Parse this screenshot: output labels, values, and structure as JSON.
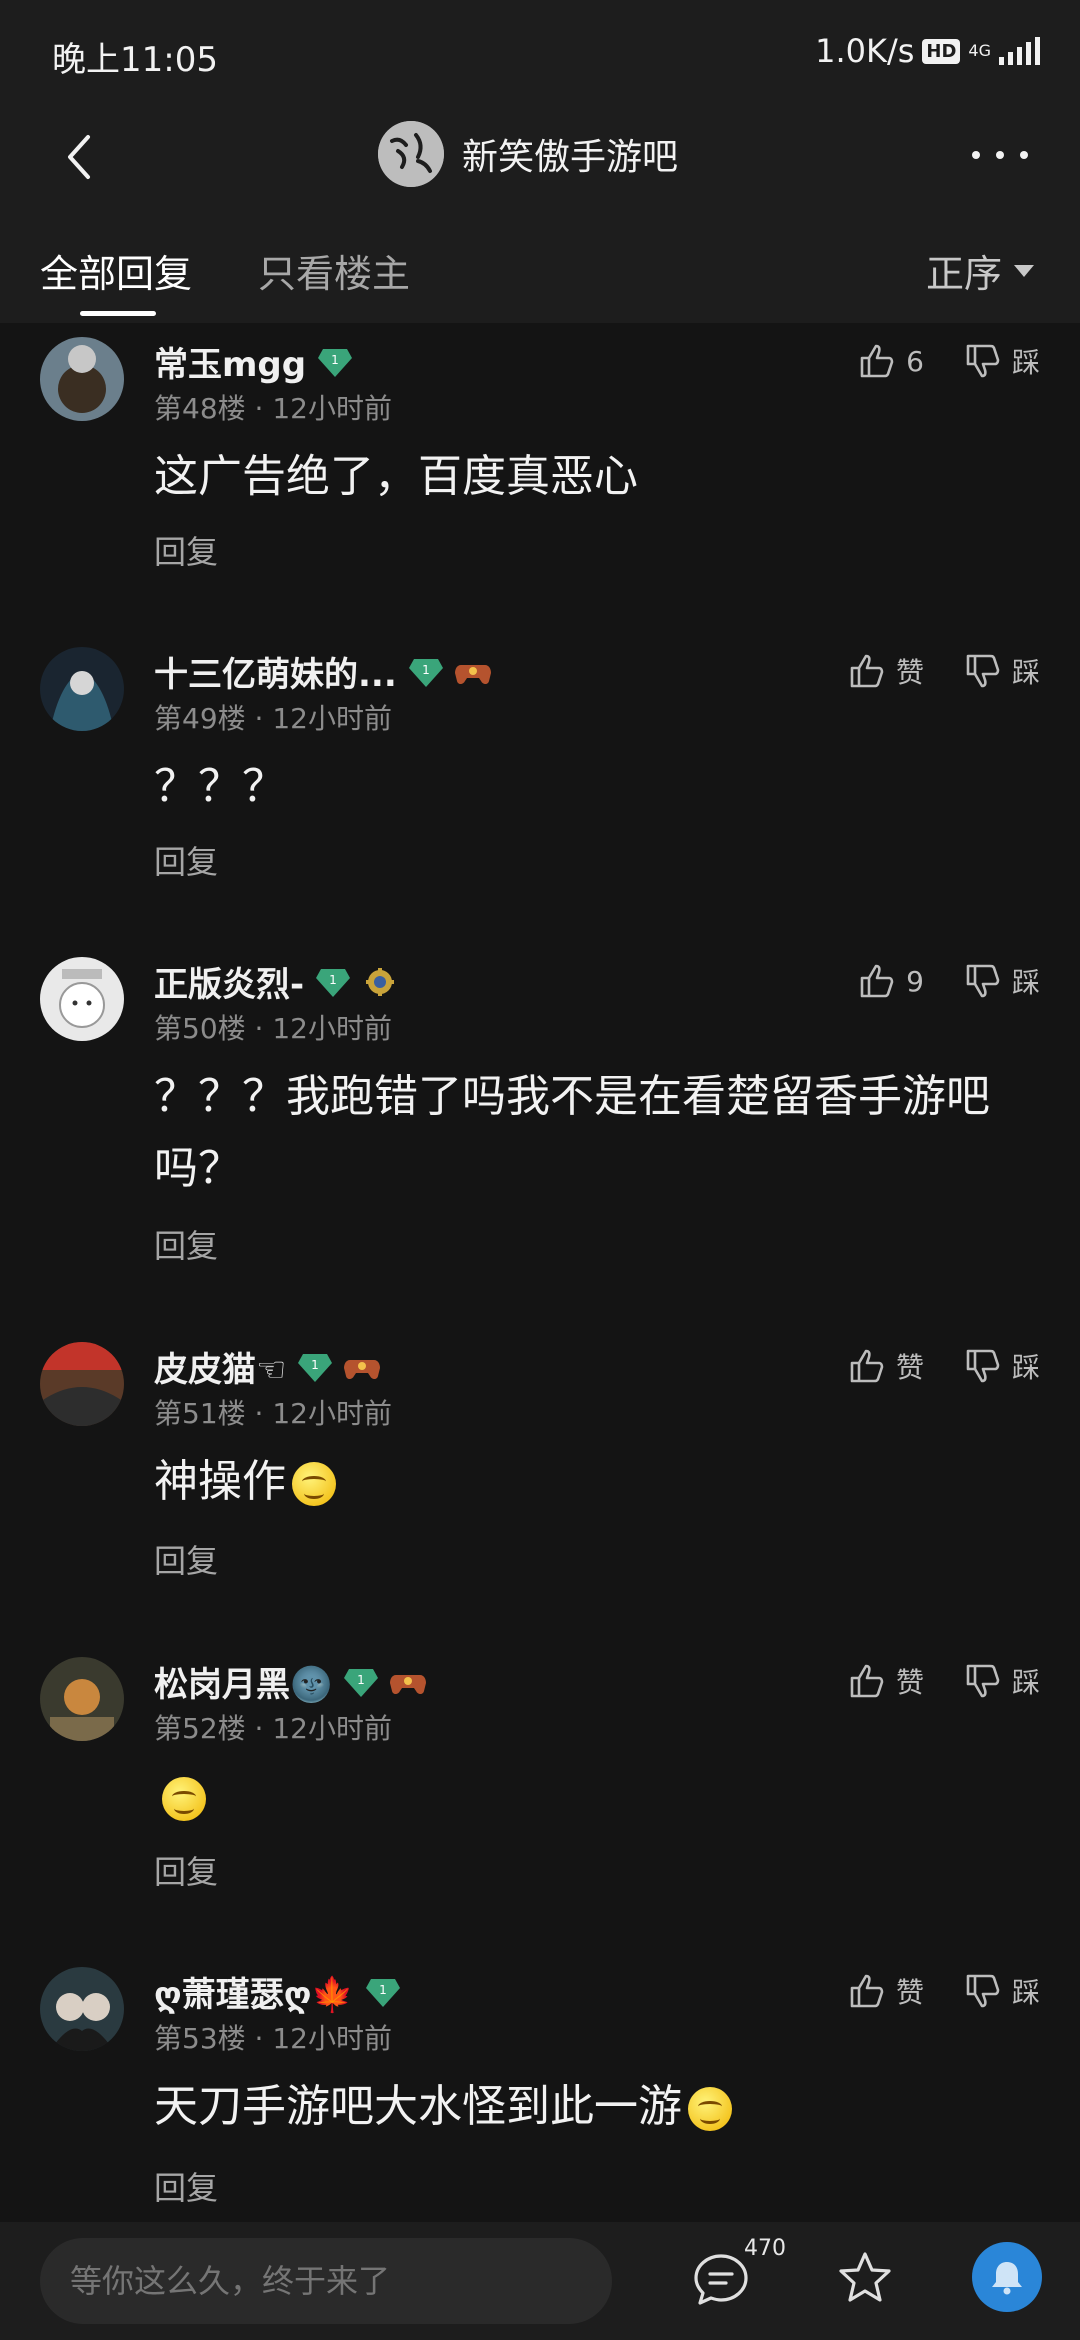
{
  "status_bar": {
    "time": "晚上11:05",
    "speed": "1.0K/s",
    "hd": "HD",
    "network": "4G"
  },
  "nav": {
    "forum_title": "新笑傲手游吧",
    "forum_avatar_text": "笑傲江湖"
  },
  "tabs": {
    "all": "全部回复",
    "owner_only": "只看楼主",
    "sort": "正序"
  },
  "replies": [
    {
      "username": "常玉mgg",
      "level": "1",
      "floor_time": "第48楼 · 12小时前",
      "content": "这广告绝了，百度真恶心",
      "likes": "6",
      "dislike": "踩",
      "reply": "回复"
    },
    {
      "username": "十三亿萌妹的...",
      "level": "1",
      "floor_time": "第49楼 · 12小时前",
      "content": "？？？",
      "likes": "赞",
      "dislike": "踩",
      "reply": "回复"
    },
    {
      "username": "正版炎烈-",
      "level": "1",
      "floor_time": "第50楼 · 12小时前",
      "content": "？？？我跑错了吗我不是在看楚留香手游吧吗？",
      "likes": "9",
      "dislike": "踩",
      "reply": "回复"
    },
    {
      "username": "皮皮猫☜",
      "level": "1",
      "floor_time": "第51楼 · 12小时前",
      "content": "神操作",
      "likes": "赞",
      "dislike": "踩",
      "reply": "回复"
    },
    {
      "username": "松岗月黑🌚",
      "level": "1",
      "floor_time": "第52楼 · 12小时前",
      "content": "",
      "likes": "赞",
      "dislike": "踩",
      "reply": "回复"
    },
    {
      "username": "ღ萧瑾瑟ღ🍁",
      "level": "1",
      "floor_time": "第53楼 · 12小时前",
      "content": "天刀手游吧大水怪到此一游",
      "likes": "赞",
      "dislike": "踩",
      "reply": "回复"
    }
  ],
  "bottom_bar": {
    "input_placeholder": "等你这么久，终于来了",
    "comment_count": "470"
  },
  "colors": {
    "background": "#141414",
    "bar": "#1d1d1d",
    "progress": "#2cc53c",
    "accent_blue": "#2a86d8",
    "level_badge": "#3aa57a"
  },
  "icons": [
    "back-icon",
    "more-icon",
    "thumb-up-icon",
    "thumb-down-icon",
    "comment-icon",
    "star-icon",
    "bell-icon",
    "level-badge-icon",
    "game-badge-icon"
  ]
}
